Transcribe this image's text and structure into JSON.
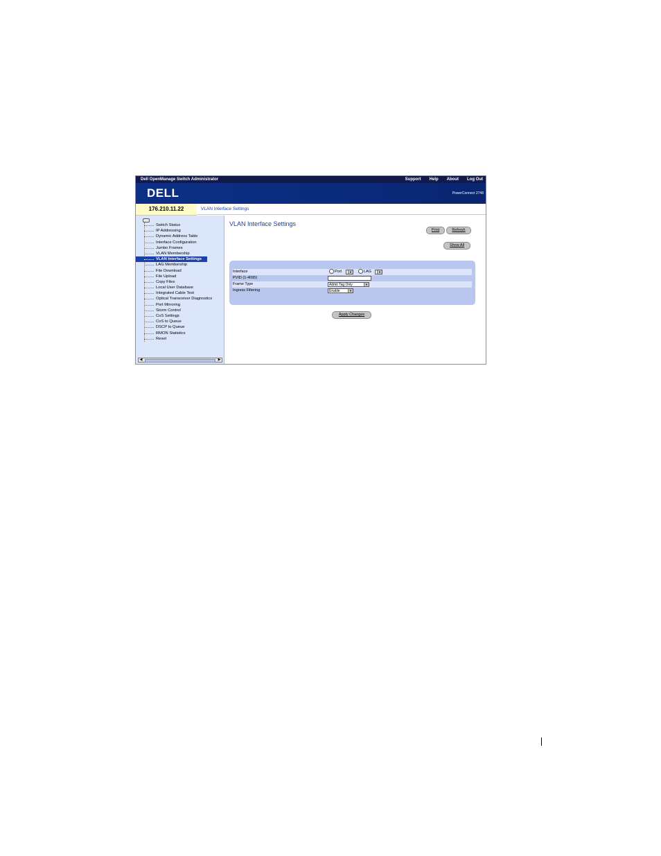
{
  "topbar": {
    "title": "Dell OpenManage Switch Administrator",
    "links": [
      "Support",
      "Help",
      "About",
      "Log Out"
    ]
  },
  "banner": {
    "logo": "DELL",
    "model": "PowerConnect 2748"
  },
  "ip_address": "176.210.11.22",
  "breadcrumb": "VLAN Interface Settings",
  "sidebar": {
    "items": [
      "Switch Status",
      "IP Addressing",
      "Dynamic Address Table",
      "Interface Configuration",
      "Jumbo Frames",
      "VLAN Membership",
      "VLAN Interface Settings",
      "LAG Membership",
      "File Download",
      "File Upload",
      "Copy Files",
      "Local User Database",
      "Integrated Cable Test",
      "Optical Transceiver Diagnostics",
      "Port Mirroring",
      "Storm Control",
      "CoS Settings",
      "CoS to Queue",
      "DSCP to Queue",
      "RMON Statistics",
      "Reset"
    ],
    "active_item": "VLAN Interface Settings"
  },
  "main": {
    "title": "VLAN Interface Settings",
    "buttons": {
      "print": "Print",
      "refresh": "Refresh",
      "show_all": "Show All",
      "apply": "Apply Changes"
    },
    "form": {
      "interface_label": "Interface",
      "port_label": "Port",
      "lag_label": "LAG",
      "pvid_label": "PVID (1-4095)",
      "pvid_value": "",
      "frame_type_label": "Frame Type",
      "frame_type_value": "Admit Tag Only",
      "ingress_label": "Ingress Filtering",
      "ingress_value": "Enable"
    }
  }
}
